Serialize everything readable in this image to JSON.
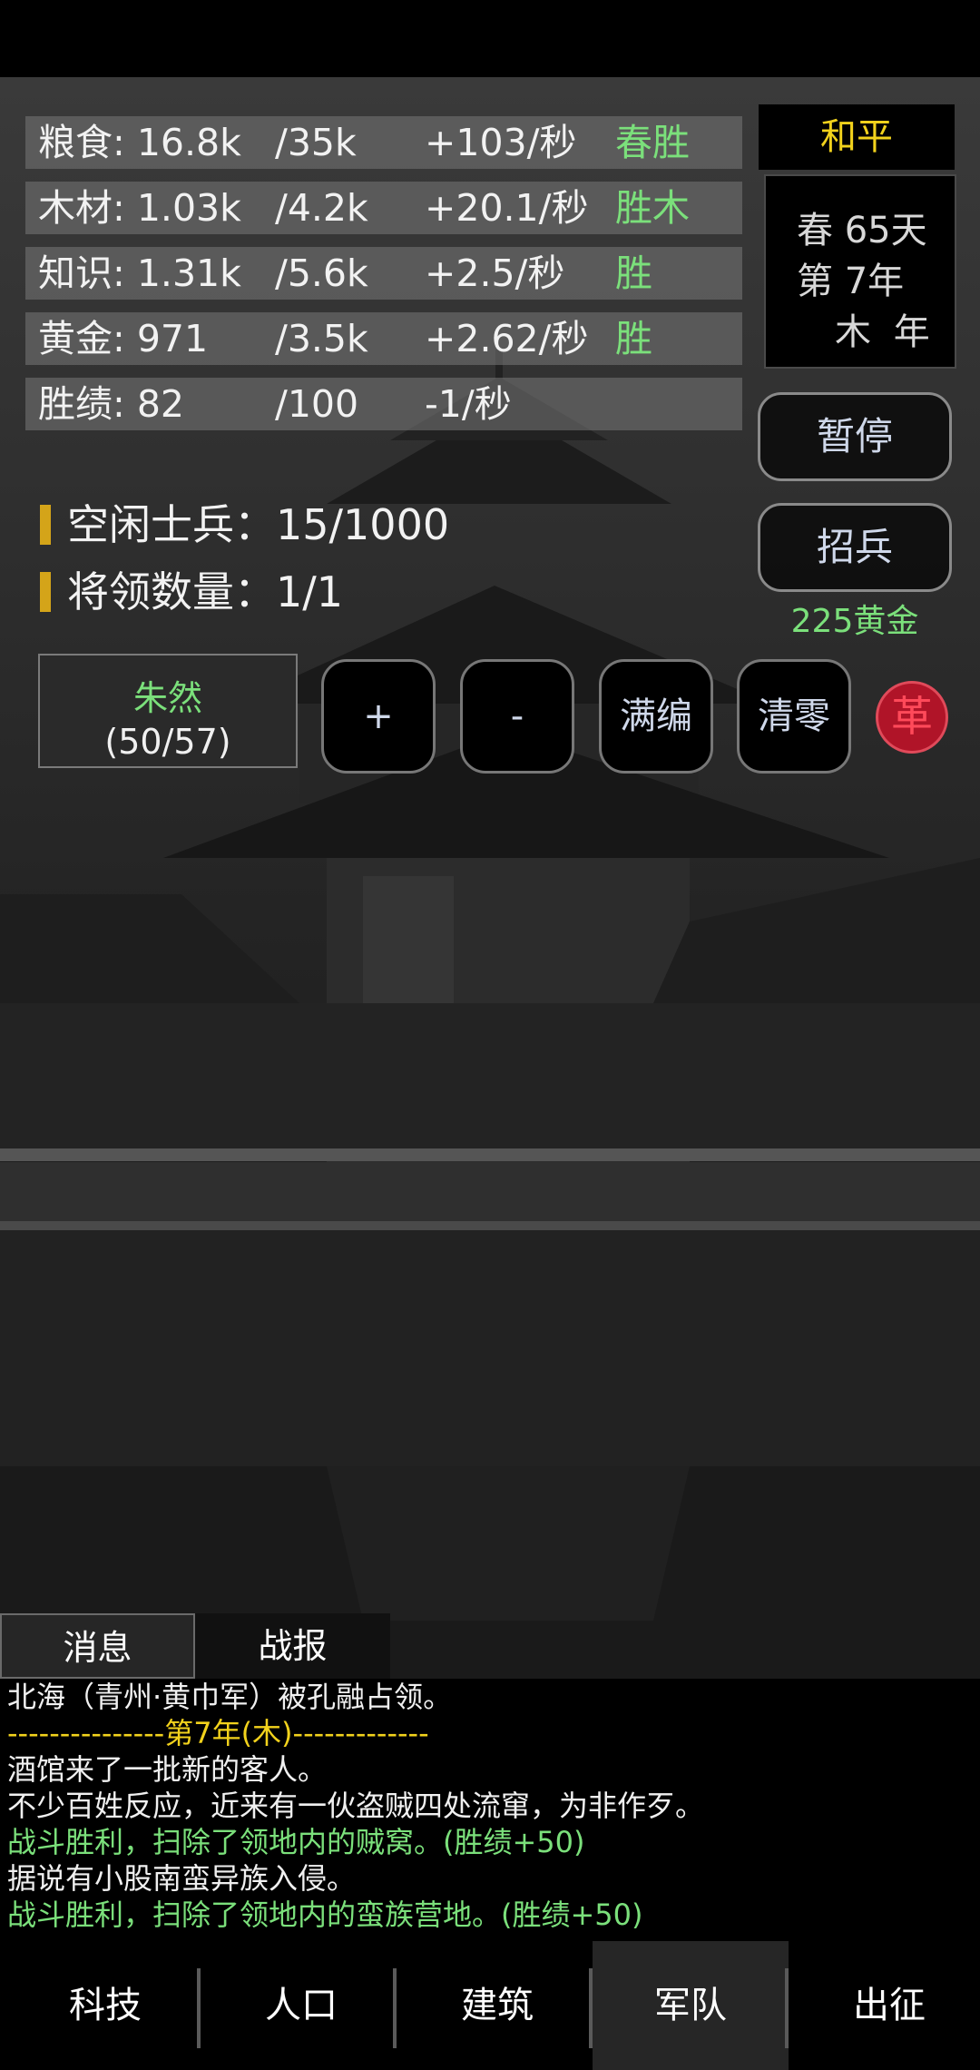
{
  "resources": [
    {
      "name": "粮食: 16.8k",
      "max": "/35k",
      "rate": "+103/秒",
      "tag": "春胜"
    },
    {
      "name": "木材: 1.03k",
      "max": "/4.2k",
      "rate": "+20.1/秒",
      "tag": "胜木"
    },
    {
      "name": "知识: 1.31k",
      "max": "/5.6k",
      "rate": "+2.5/秒",
      "tag": "胜"
    },
    {
      "name": "黄金: 971",
      "max": "/3.5k",
      "rate": "+2.62/秒",
      "tag": "胜"
    },
    {
      "name": "胜绩: 82",
      "max": "/100",
      "rate": "-1/秒",
      "tag": ""
    }
  ],
  "status": {
    "state": "和平",
    "season_day": "春 65天",
    "year": "第 7年",
    "element_year": "木 年"
  },
  "controls": {
    "pause": "暂停",
    "recruit": "招兵",
    "recruit_cost": "225黄金"
  },
  "army": {
    "idle_soldiers": "空闲士兵：15/1000",
    "generals": "将领数量：1/1"
  },
  "general": {
    "name": "朱然",
    "count": "(50/57)"
  },
  "buttons": {
    "plus": "+",
    "minus": "-",
    "full": "满编",
    "clear": "清零",
    "revolt": "革"
  },
  "log": {
    "tabs": [
      "消息",
      "战报"
    ],
    "lines": [
      {
        "text": "北海（青州·黄巾军）被孔融占领。",
        "color": "white"
      },
      {
        "text": "---------------第7年(木)-------------",
        "color": "yellow"
      },
      {
        "text": "酒馆来了一批新的客人。",
        "color": "white"
      },
      {
        "text": "不少百姓反应，近来有一伙盗贼四处流窜，为非作歹。",
        "color": "white"
      },
      {
        "text": "战斗胜利，扫除了领地内的贼窝。(胜绩+50)",
        "color": "green"
      },
      {
        "text": "据说有小股南蛮异族入侵。",
        "color": "white"
      },
      {
        "text": "战斗胜利，扫除了领地内的蛮族营地。(胜绩+50)",
        "color": "green"
      }
    ]
  },
  "nav": {
    "items": [
      "科技",
      "人口",
      "建筑",
      "军队",
      "出征"
    ],
    "active": "军队"
  },
  "colors": {
    "accent_green": "#7be07b",
    "accent_yellow": "#f2d21c",
    "revolt_red": "#b01428"
  }
}
